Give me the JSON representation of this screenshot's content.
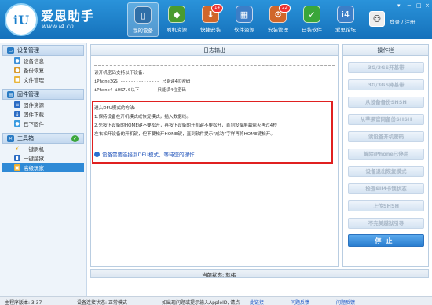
{
  "header": {
    "logo_text": "iU",
    "brand": "爱思助手",
    "site": "www.i4.cn",
    "nav": [
      {
        "label": "我的设备",
        "icon": "phone-icon",
        "active": true,
        "badge": ""
      },
      {
        "label": "刷机资源",
        "icon": "store-icon",
        "active": false,
        "badge": ""
      },
      {
        "label": "快捷安装",
        "icon": "install-icon",
        "active": false,
        "badge": "14"
      },
      {
        "label": "软件资源",
        "icon": "apps-icon",
        "active": false,
        "badge": ""
      },
      {
        "label": "安装管理",
        "icon": "manage-icon",
        "active": false,
        "badge": "22"
      },
      {
        "label": "已装软件",
        "icon": "installed-icon",
        "active": false,
        "badge": ""
      },
      {
        "label": "爱思论坛",
        "icon": "forum-icon",
        "active": false,
        "badge": ""
      }
    ],
    "login": "登录 / 注册"
  },
  "sidebar": {
    "sections": [
      {
        "title": "设备管理",
        "items": [
          "设备信息",
          "备份恢复",
          "文件管理"
        ]
      },
      {
        "title": "固件管理",
        "items": [
          "固件资源",
          "固件下载",
          "已下固件"
        ]
      },
      {
        "title": "工具箱",
        "items": [
          "一键刷机",
          "一键越狱",
          "高级玩家"
        ]
      }
    ]
  },
  "log": {
    "title": "日志输出",
    "lines": [
      "读开机密码支持以下设备:",
      "iPhone3GS  ---------------  只能读4位密码",
      "iPhone4  iOS7.0以下------  只能读4位密码",
      "进入DFU模式的方法:",
      "1.保持设备在开机模式或恢复模式，插入数据线。",
      "2.先按下设备的HOME键不要松开，再按下设备的开机键不要松开，直到设备屏幕熄灭再过4秒",
      "  左右松开设备的开机键，但不要松开HOME键，直到软件提示“成功”字样再将HOME键松开。"
    ],
    "warning": "设备需要连接到DFU模式，等待您的操作......................"
  },
  "actions": {
    "title": "操作栏",
    "buttons": [
      "3G/3GS开基带",
      "3G/3GS降基带",
      "从设备备份SHSH",
      "从苹果官网备份SHSH",
      "读设备开机密码",
      "解除iPhone已停用",
      "设备退出恢复模式",
      "检查SIM卡锁状态",
      "上传SHSH",
      "不完美越狱引导"
    ],
    "stop": "停止"
  },
  "progress": {
    "value": 0,
    "status": "当前状态: 就绪"
  },
  "statusbar": {
    "version": "主程序版本: 3.37",
    "connection": "设备连接状态: 正常模式",
    "hint_prefix": "如出现问题或提示输入AppleID, 请点",
    "hint_link": "此链接",
    "feedback1": "问题反馈",
    "feedback2": "问题反馈"
  },
  "colors": {
    "accent": "#1a7fcc",
    "warning_box": "#e02020",
    "stop_button": "#2a7ed0"
  }
}
